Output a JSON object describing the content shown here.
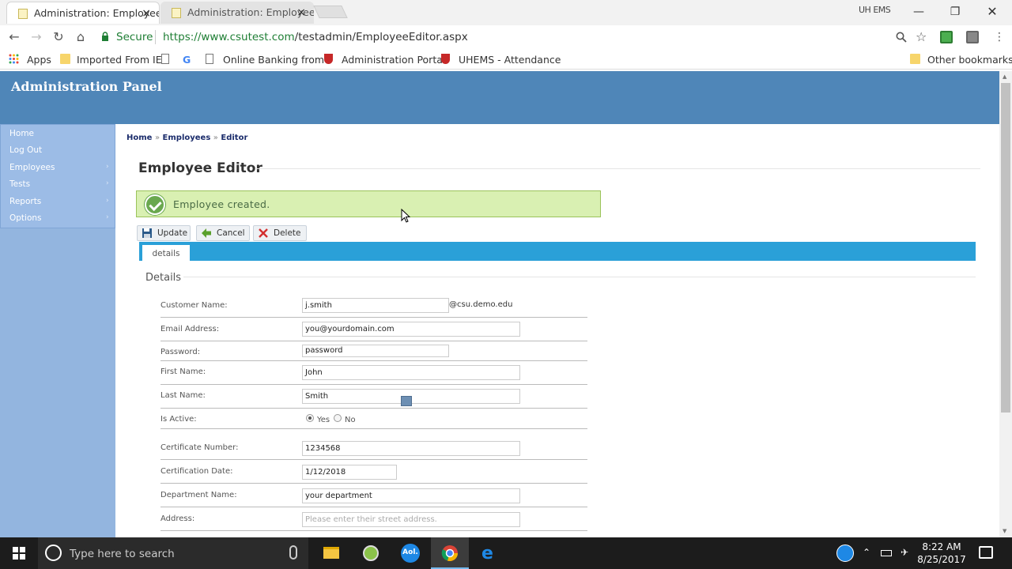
{
  "browser": {
    "tabs": [
      {
        "title": "Administration: Employee",
        "close": "×"
      },
      {
        "title": "Administration: Employee",
        "close": "×"
      }
    ],
    "profile": "UH EMS",
    "secure_label": "Secure",
    "url_host": "https://www.csutest.com",
    "url_path": "/testadmin/EmployeeEditor.aspx",
    "bookmarks": [
      "Apps",
      "Imported From IE",
      "Online Banking from",
      "Administration Portal",
      "UHEMS - Attendance"
    ],
    "other_bookmarks": "Other bookmarks"
  },
  "header": {
    "title": "Administration Panel"
  },
  "menu": [
    {
      "label": "Home",
      "arrow": ""
    },
    {
      "label": "Log Out",
      "arrow": ""
    },
    {
      "label": "Employees",
      "arrow": "›"
    },
    {
      "label": "Tests",
      "arrow": "›"
    },
    {
      "label": "Reports",
      "arrow": "›"
    },
    {
      "label": "Options",
      "arrow": "›"
    }
  ],
  "breadcrumb": {
    "home": "Home",
    "employees": "Employees",
    "editor": "Editor",
    "sep": "»"
  },
  "page_title": "Employee Editor",
  "message": "Employee created.",
  "buttons": {
    "update": "Update",
    "cancel": "Cancel",
    "delete": "Delete"
  },
  "tab": "details",
  "section": "Details",
  "form": {
    "customer_name": {
      "label": "Customer Name:",
      "value": "j.smith",
      "suffix": "@csu.demo.edu"
    },
    "email": {
      "label": "Email Address:",
      "value": "you@yourdomain.com"
    },
    "password": {
      "label": "Password:",
      "value": "password"
    },
    "first_name": {
      "label": "First Name:",
      "value": "John"
    },
    "last_name": {
      "label": "Last Name:",
      "value": "Smith"
    },
    "is_active": {
      "label": "Is Active:",
      "yes": "Yes",
      "no": "No",
      "selected": "Yes"
    },
    "certificate": {
      "label": "Certificate Number:",
      "value": "1234568"
    },
    "cert_date": {
      "label": "Certification Date:",
      "value": "1/12/2018"
    },
    "department": {
      "label": "Department Name:",
      "value": "your department"
    },
    "address": {
      "label": "Address:",
      "placeholder": "Please enter their street address."
    }
  },
  "taskbar": {
    "search_placeholder": "Type here to search",
    "time": "8:22 AM",
    "date": "8/25/2017",
    "aol": "Aol."
  }
}
